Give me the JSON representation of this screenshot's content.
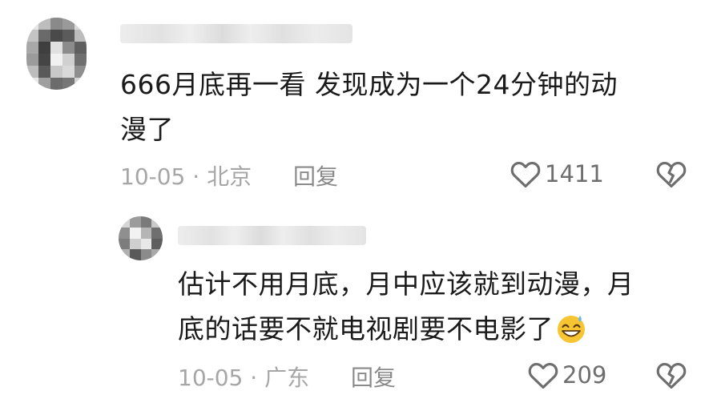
{
  "comments": [
    {
      "content_line1": "666月底再一看 发现成为一个24分钟的动",
      "content_line2": "漫了",
      "date": "10-05",
      "location": "北京",
      "reply_label": "回复",
      "likes": "1411"
    },
    {
      "content_line1": "估计不用月底，月中应该就到动漫，月",
      "content_line2": "底的话要不就电视剧要不电影了",
      "emoji": "grinning-face-with-sweat-emoji",
      "date": "10-05",
      "location": "广东",
      "reply_label": "回复",
      "likes": "209"
    }
  ],
  "icons": {
    "like": "heart-outline-icon",
    "dislike": "broken-heart-icon"
  },
  "colors": {
    "text": "#1a1a1a",
    "meta": "#a6a6a6",
    "reply": "#8a8a8a",
    "icon": "#6e6e6e",
    "emoji": "#f7c531"
  }
}
